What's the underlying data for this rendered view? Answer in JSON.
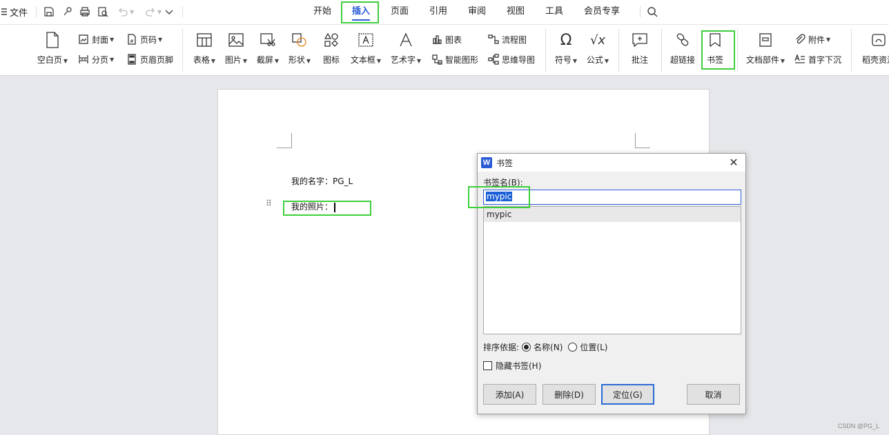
{
  "menubar": {
    "file_label": "文件",
    "tabs": [
      "开始",
      "插入",
      "页面",
      "引用",
      "审阅",
      "视图",
      "工具",
      "会员专享"
    ],
    "active_tab": "插入"
  },
  "ribbon": {
    "blank_page": "空白页",
    "cover": "封面",
    "page_break": "分页",
    "page_number": "页码",
    "header_footer": "页眉页脚",
    "table": "表格",
    "picture": "图片",
    "screenshot": "截屏",
    "shape": "形状",
    "icon": "图标",
    "textbox": "文本框",
    "wordart": "艺术字",
    "chart": "图表",
    "smart_graphic": "智能图形",
    "flowchart": "流程图",
    "mindmap": "思维导图",
    "symbol": "符号",
    "formula": "公式",
    "comment": "批注",
    "hyperlink": "超链接",
    "bookmark": "书签",
    "doc_parts": "文档部件",
    "attachment": "附件",
    "drop_cap": "首字下沉",
    "resources": "稻壳资源"
  },
  "document": {
    "line1": "我的名字：PG_L",
    "line2": "我的照片："
  },
  "dialog": {
    "title": "书签",
    "field_label": "书签名(B):",
    "input_value": "mypic",
    "list_items": [
      "mypic"
    ],
    "sort_label": "排序依据:",
    "sort_by_name": "名称(N)",
    "sort_by_position": "位置(L)",
    "hide_label": "隐藏书签(H)",
    "add_button": "添加(A)",
    "delete_button": "删除(D)",
    "goto_button": "定位(G)",
    "cancel_button": "取消"
  },
  "watermark": "CSDN @PG_L",
  "colors": {
    "accent": "#2a5ad6",
    "highlight": "#3ccf3c"
  }
}
